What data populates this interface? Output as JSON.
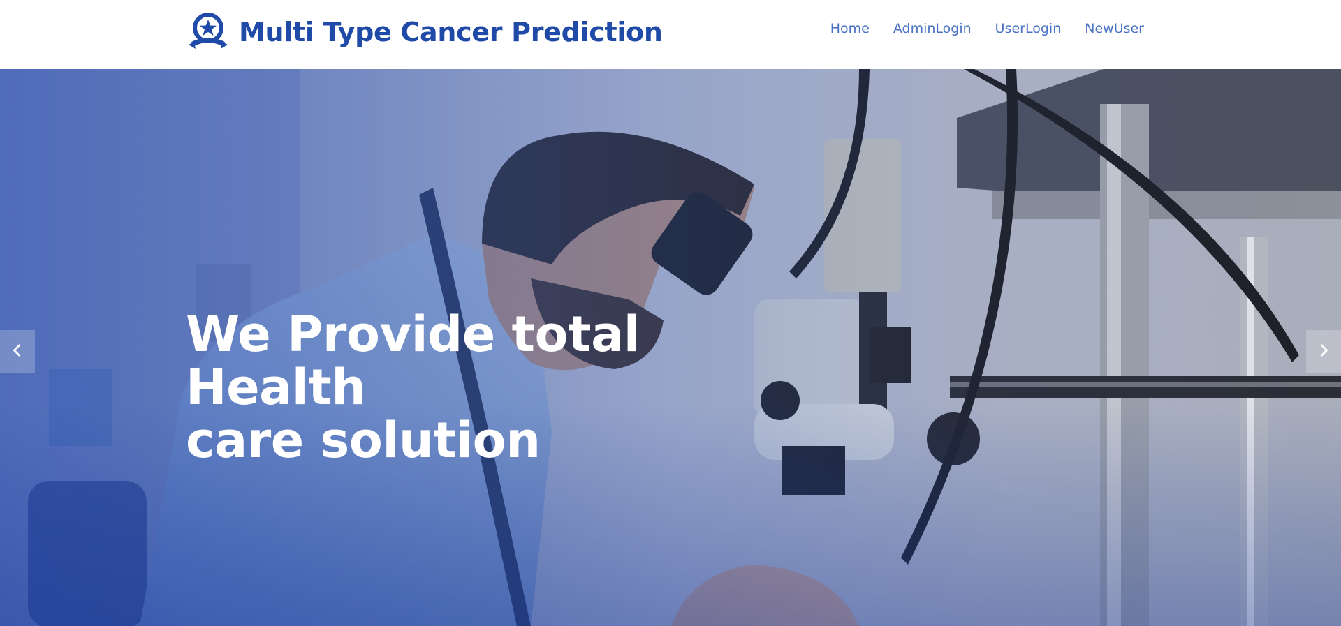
{
  "brand": {
    "title": "Multi Type Cancer Prediction",
    "logo_icon": "award-star-icon",
    "color": "#1f4aa8"
  },
  "nav": {
    "items": [
      {
        "label": "Home"
      },
      {
        "label": "AdminLogin"
      },
      {
        "label": "UserLogin"
      },
      {
        "label": "NewUser"
      }
    ],
    "color": "#4a72c4"
  },
  "hero": {
    "heading_line1": "We Provide total Health",
    "heading_line2": "care solution",
    "prev_icon": "chevron-left-icon",
    "next_icon": "chevron-right-icon",
    "overlay_color": "#284eb4"
  }
}
